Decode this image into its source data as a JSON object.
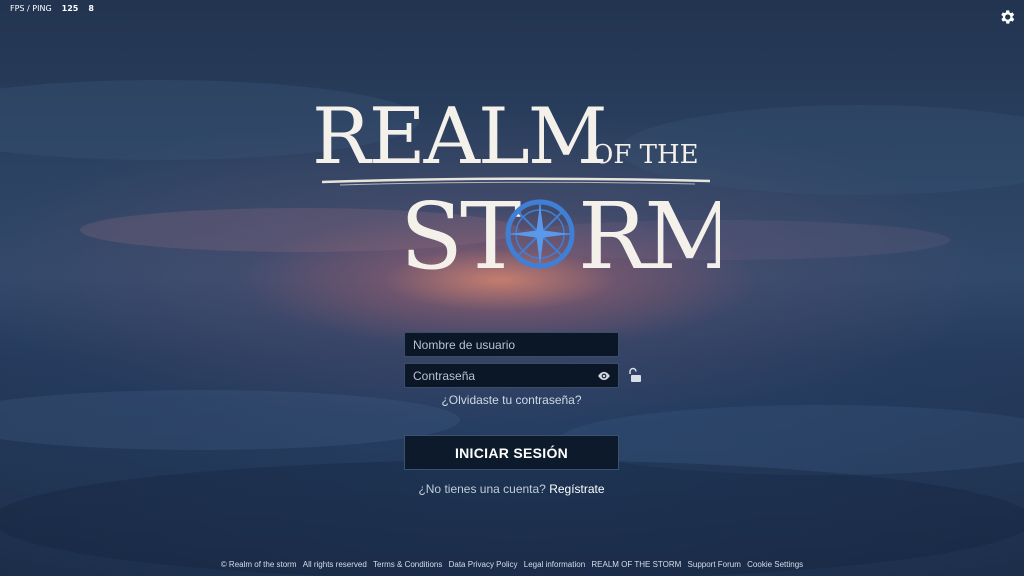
{
  "hud": {
    "label": "FPS / PING",
    "fps": "125",
    "ping": "8"
  },
  "settings": {
    "icon": "gear-icon"
  },
  "logo": {
    "word1": "REALM",
    "word2": "OF THE",
    "word3a": "ST",
    "word3b": "RM",
    "accent": "#3f7fd6"
  },
  "form": {
    "username_placeholder": "Nombre de usuario",
    "password_placeholder": "Contraseña",
    "forgot": "¿Olvidaste tu contraseña?",
    "login": "INICIAR SESIÓN",
    "no_account": "¿No tienes una cuenta?",
    "register": "Regístrate"
  },
  "footer": {
    "copyright": "© Realm of the storm",
    "rights": "All rights reserved",
    "links": [
      "Terms & Conditions",
      "Data Privacy Policy",
      "Legal information",
      "REALM OF THE STORM",
      "Support Forum",
      "Cookie Settings"
    ]
  }
}
